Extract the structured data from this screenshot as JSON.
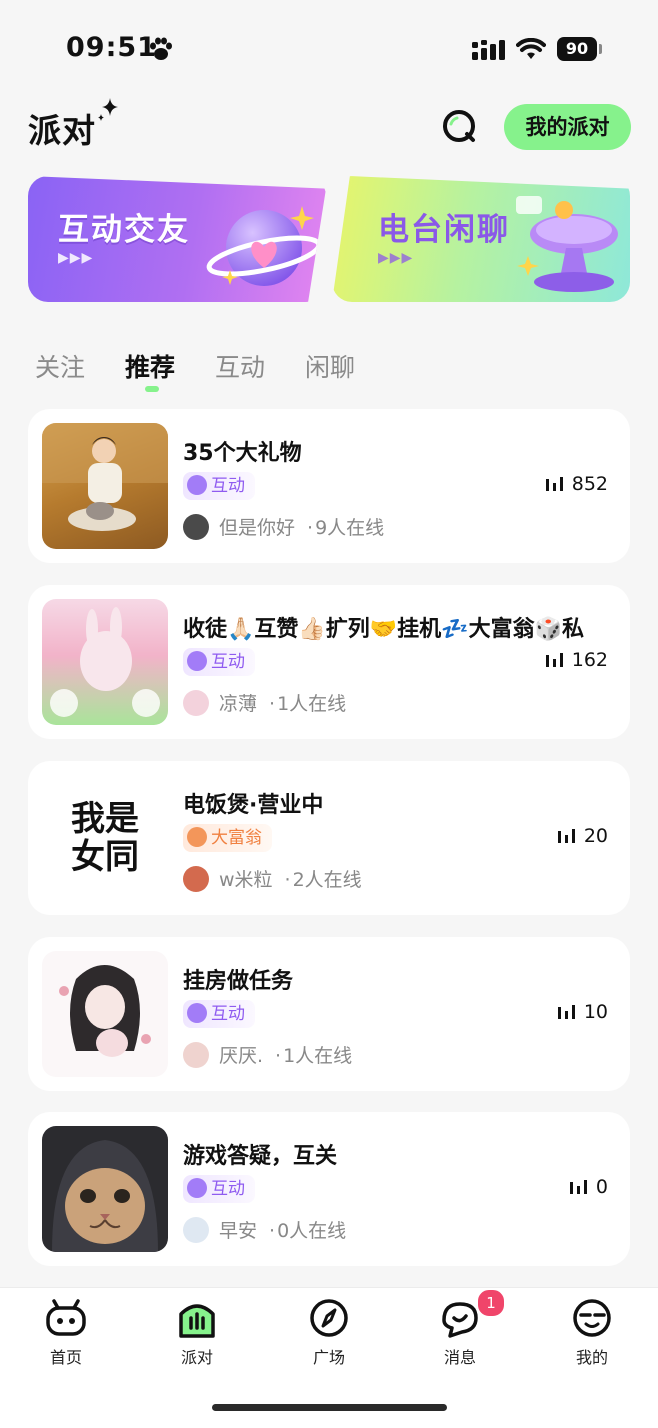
{
  "status_bar": {
    "time": "09:51",
    "battery": "90"
  },
  "header": {
    "title": "派对",
    "my_party_label": "我的派对"
  },
  "banners": [
    {
      "label": "互动交友",
      "arrows": "▶▶▶"
    },
    {
      "label": "电台闲聊",
      "arrows": "▶▶▶"
    }
  ],
  "tabs": [
    {
      "label": "关注",
      "active": false
    },
    {
      "label": "推荐",
      "active": true
    },
    {
      "label": "互动",
      "active": false
    },
    {
      "label": "闲聊",
      "active": false
    }
  ],
  "rooms": [
    {
      "title": "35个大礼物",
      "tag": "互动",
      "tag_style": "purple",
      "listeners": "852",
      "host": "但是你好",
      "online": "9人在线",
      "thumb_text": ""
    },
    {
      "title": "收徒🙏🏻互赞👍🏻扩列🤝挂机💤大富翁🎲私",
      "tag": "互动",
      "tag_style": "purple",
      "listeners": "162",
      "host": "凉薄",
      "online": "1人在线",
      "thumb_text": ""
    },
    {
      "title": "电饭煲·营业中",
      "tag": "大富翁",
      "tag_style": "orange",
      "listeners": "20",
      "host": "w米粒",
      "online": "2人在线",
      "thumb_text": "我是\n女同"
    },
    {
      "title": "挂房做任务",
      "tag": "互动",
      "tag_style": "purple",
      "listeners": "10",
      "host": "厌厌.",
      "online": "1人在线",
      "thumb_text": ""
    },
    {
      "title": "游戏答疑，互关",
      "tag": "互动",
      "tag_style": "purple",
      "listeners": "0",
      "host": "早安",
      "online": "0人在线",
      "thumb_text": ""
    }
  ],
  "dot_separator": "·",
  "bottom_nav": [
    {
      "label": "首页",
      "icon": "gamepad-icon"
    },
    {
      "label": "派对",
      "icon": "party-icon"
    },
    {
      "label": "广场",
      "icon": "compass-icon"
    },
    {
      "label": "消息",
      "icon": "message-icon"
    },
    {
      "label": "我的",
      "icon": "profile-face-icon"
    }
  ],
  "message_badge": "1",
  "colors": {
    "accent_green": "#86f28c",
    "tag_purple": "#8f5bf0",
    "tag_orange": "#f08040",
    "badge_red": "#f0456a"
  }
}
